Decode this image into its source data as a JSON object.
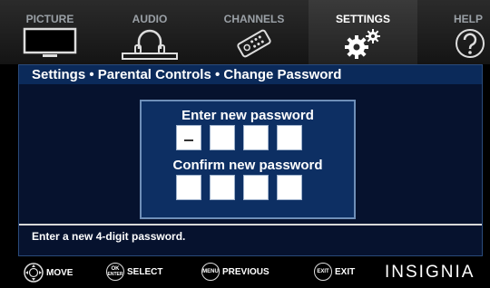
{
  "tabs": [
    {
      "label": "PICTURE",
      "icon": "tv-icon"
    },
    {
      "label": "AUDIO",
      "icon": "headphones-icon"
    },
    {
      "label": "CHANNELS",
      "icon": "remote-icon"
    },
    {
      "label": "SETTINGS",
      "icon": "gears-icon",
      "active": true
    },
    {
      "label": "HELP",
      "icon": "help-icon"
    }
  ],
  "breadcrumb": "Settings • Parental Controls  • Change Password",
  "dialog": {
    "new_label": "Enter new password",
    "confirm_label": "Confirm new password",
    "new_digits": [
      "",
      "",
      "",
      ""
    ],
    "confirm_digits": [
      "",
      "",
      "",
      ""
    ]
  },
  "help_text": "Enter a new 4-digit password.",
  "footer": {
    "move": "MOVE",
    "ok_key_top": "OK",
    "ok_key_bottom": "ENTER",
    "select": "SELECT",
    "menu_key": "MENU",
    "previous": "PREVIOUS",
    "exit_key": "EXIT",
    "exit": "EXIT"
  },
  "brand": "INSIGNIA",
  "colors": {
    "panel_bg": "#06122e",
    "dialog_bg": "#0d2f63",
    "crumb_bg": "#0b2a5a"
  }
}
